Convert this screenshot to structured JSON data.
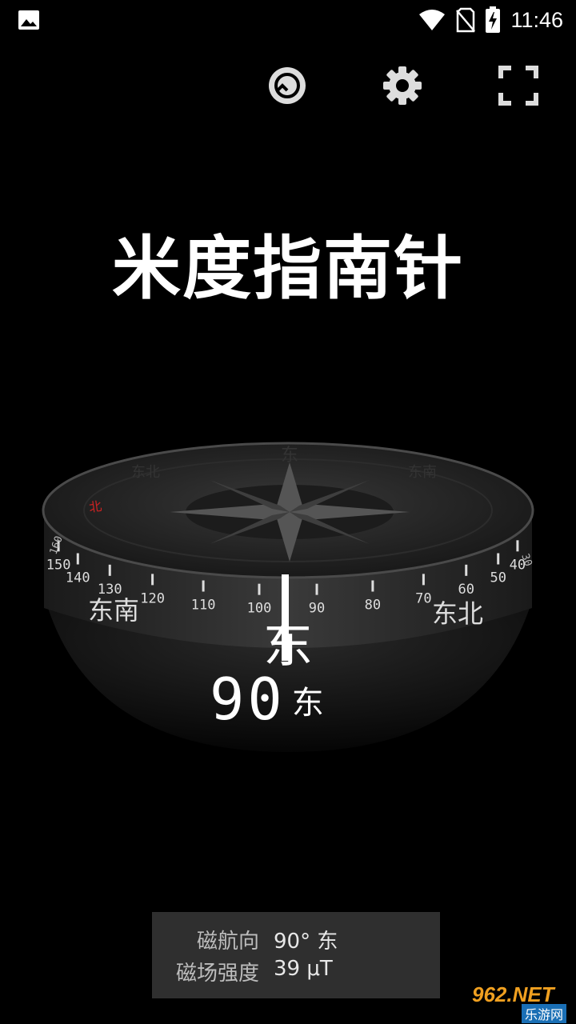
{
  "status_bar": {
    "time": "11:46",
    "icons": [
      "image-icon",
      "wifi-icon",
      "no-sim-icon",
      "battery-charging-icon"
    ]
  },
  "toolbar": {
    "icons": [
      "calibrate-icon",
      "gear-icon",
      "fullscreen-icon"
    ]
  },
  "app": {
    "title": "米度指南针"
  },
  "compass": {
    "heading_value": "90",
    "heading_dir": "东",
    "center_dir": "东",
    "left_dir": "东南",
    "right_dir": "东北",
    "scale_ticks": [
      "150",
      "140",
      "130",
      "120",
      "110",
      "100",
      "90",
      "80",
      "70",
      "60",
      "50",
      "40"
    ],
    "side_ticks_left": [
      "160"
    ],
    "side_ticks_right": [
      "30"
    ],
    "top_cardinal": "东",
    "top_left": "东北",
    "top_right": "东南",
    "accent_color": "#cc2222"
  },
  "info": {
    "heading_label": "磁航向",
    "heading_value": "90° 东",
    "field_label": "磁场强度",
    "field_value": "39 μT"
  },
  "watermark": {
    "brand": "962.NET",
    "sub": "乐游网"
  }
}
